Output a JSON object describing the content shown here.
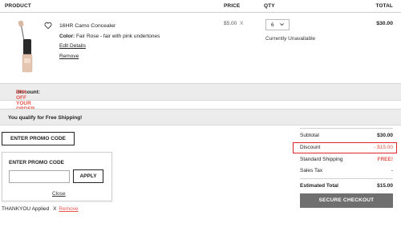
{
  "header": {
    "product": "PRODUCT",
    "price": "PRICE",
    "qty": "QTY",
    "total": "TOTAL"
  },
  "item": {
    "name": "16HR Camo Concealer",
    "color_label": "Color:",
    "color_value": "Fair Rose - fair with pink undertones",
    "edit_label": "Edit Details",
    "remove_label": "Remove",
    "price": "$5.00",
    "times": "X",
    "qty": "6",
    "availability": "Currently Unavailable",
    "line_total": "$30.00"
  },
  "discount_banner": {
    "label": "Discount:",
    "offer": "50% OFF YOUR ORDER OF $30+!"
  },
  "shipping_banner": {
    "text": "You qualify for Free Shipping!"
  },
  "promo": {
    "button_label": "ENTER PROMO CODE",
    "panel_title": "ENTER PROMO CODE",
    "input_value": "",
    "apply_label": "APPLY",
    "close_label": "Close",
    "applied_code": "THANKYOU",
    "applied_text": "Applied",
    "applied_x": "X",
    "applied_remove": "Remove"
  },
  "summary": {
    "subtotal_label": "Subtotal",
    "subtotal_value": "$30.00",
    "discount_label": "Discount",
    "discount_value": "- $15.00",
    "shipping_label": "Standard Shipping",
    "shipping_value": "FREE!",
    "tax_label": "Sales Tax",
    "tax_value": "-",
    "estimated_label": "Estimated Total",
    "estimated_value": "$15.00",
    "checkout_label": "SECURE CHECKOUT"
  },
  "colors": {
    "accent": "#e8554e",
    "highlight_box": "#e0242b",
    "checkout_bg": "#6f6f6f",
    "band_bg": "#ececec"
  },
  "icons": {
    "wishlist": "heart-outline-icon",
    "qty_dropdown": "chevron-down-icon"
  }
}
